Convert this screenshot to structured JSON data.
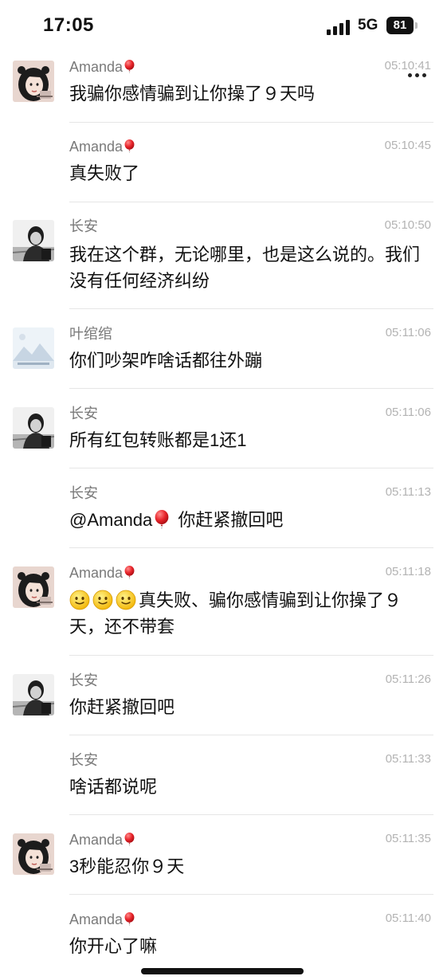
{
  "status_bar": {
    "time": "17:05",
    "network": "5G",
    "battery": "81"
  },
  "messages": [
    {
      "sender": "Amanda",
      "time": "05:10:41",
      "text": "我骗你感情骗到让你操了９天吗"
    },
    {
      "sender": "Amanda",
      "time": "05:10:45",
      "text": "真失败了"
    },
    {
      "sender": "长安",
      "time": "05:10:50",
      "text": "我在这个群，无论哪里，也是这么说的。我们没有任何经济纠纷"
    },
    {
      "sender": "叶绾绾",
      "time": "05:11:06",
      "text": "你们吵架咋啥话都往外蹦"
    },
    {
      "sender": "长安",
      "time": "05:11:06",
      "text": "所有红包转账都是1还1"
    },
    {
      "sender": "长安",
      "time": "05:11:13",
      "mention": "@Amanda",
      "text": "你赶紧撤回吧"
    },
    {
      "sender": "Amanda",
      "time": "05:11:18",
      "text": "真失败、骗你感情骗到让你操了９天，还不带套"
    },
    {
      "sender": "长安",
      "time": "05:11:26",
      "text": "你赶紧撤回吧"
    },
    {
      "sender": "长安",
      "time": "05:11:33",
      "text": "啥话都说呢"
    },
    {
      "sender": "Amanda",
      "time": "05:11:35",
      "text": "3秒能忍你９天"
    },
    {
      "sender": "Amanda",
      "time": "05:11:40",
      "text": "你开心了嘛"
    }
  ]
}
